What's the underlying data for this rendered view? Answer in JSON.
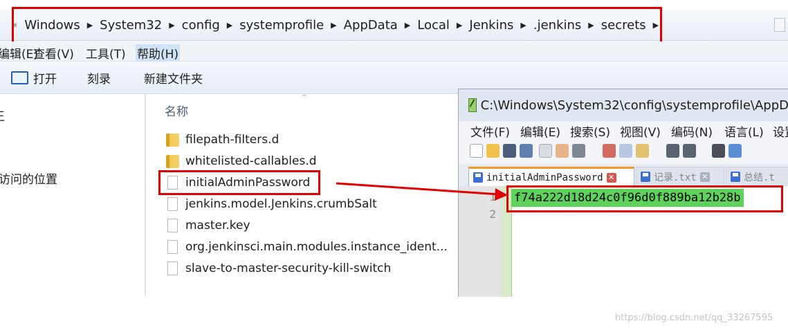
{
  "explorer": {
    "address": {
      "lead_arrow": "«",
      "crumbs": [
        "Windows",
        "System32",
        "config",
        "systemprofile",
        "AppData",
        "Local",
        "Jenkins",
        ".jenkins",
        "secrets"
      ],
      "separator": "▶"
    },
    "menu": {
      "edit": "编辑(E)",
      "view": "查看(V)",
      "tools": "工具(T)",
      "help": "帮助(H)"
    },
    "toolbar": {
      "open": "打开",
      "burn": "刻录",
      "new_folder": "新建文件夹"
    },
    "nav": {
      "item1": "王",
      "item2": "访问的位置"
    },
    "column_name": "名称",
    "sort_indicator": "^",
    "files": [
      {
        "name": "filepath-filters.d",
        "type": "folder"
      },
      {
        "name": "whitelisted-callables.d",
        "type": "folder"
      },
      {
        "name": "initialAdminPassword",
        "type": "file"
      },
      {
        "name": "jenkins.model.Jenkins.crumbSalt",
        "type": "file"
      },
      {
        "name": "master.key",
        "type": "file"
      },
      {
        "name": "org.jenkinsci.main.modules.instance_ident...",
        "type": "file"
      },
      {
        "name": "slave-to-master-security-kill-switch",
        "type": "file"
      }
    ]
  },
  "notepad": {
    "title": "C:\\Windows\\System32\\config\\systemprofile\\AppD",
    "menu": [
      "文件(F)",
      "编辑(E)",
      "搜索(S)",
      "视图(V)",
      "编码(N)",
      "语言(L)",
      "设置"
    ],
    "tabs": [
      {
        "label": "initialAdminPassword",
        "active": true
      },
      {
        "label": "记录.txt",
        "active": false
      },
      {
        "label": "总结.t",
        "active": false
      }
    ],
    "close_glyph": "✕",
    "line_numbers": [
      "1",
      "2"
    ],
    "line1": "f74a222d18d24c0f96d0f889ba12b28b"
  },
  "annotation_color": "#e00000",
  "watermark": "https://blog.csdn.net/qq_33267595"
}
